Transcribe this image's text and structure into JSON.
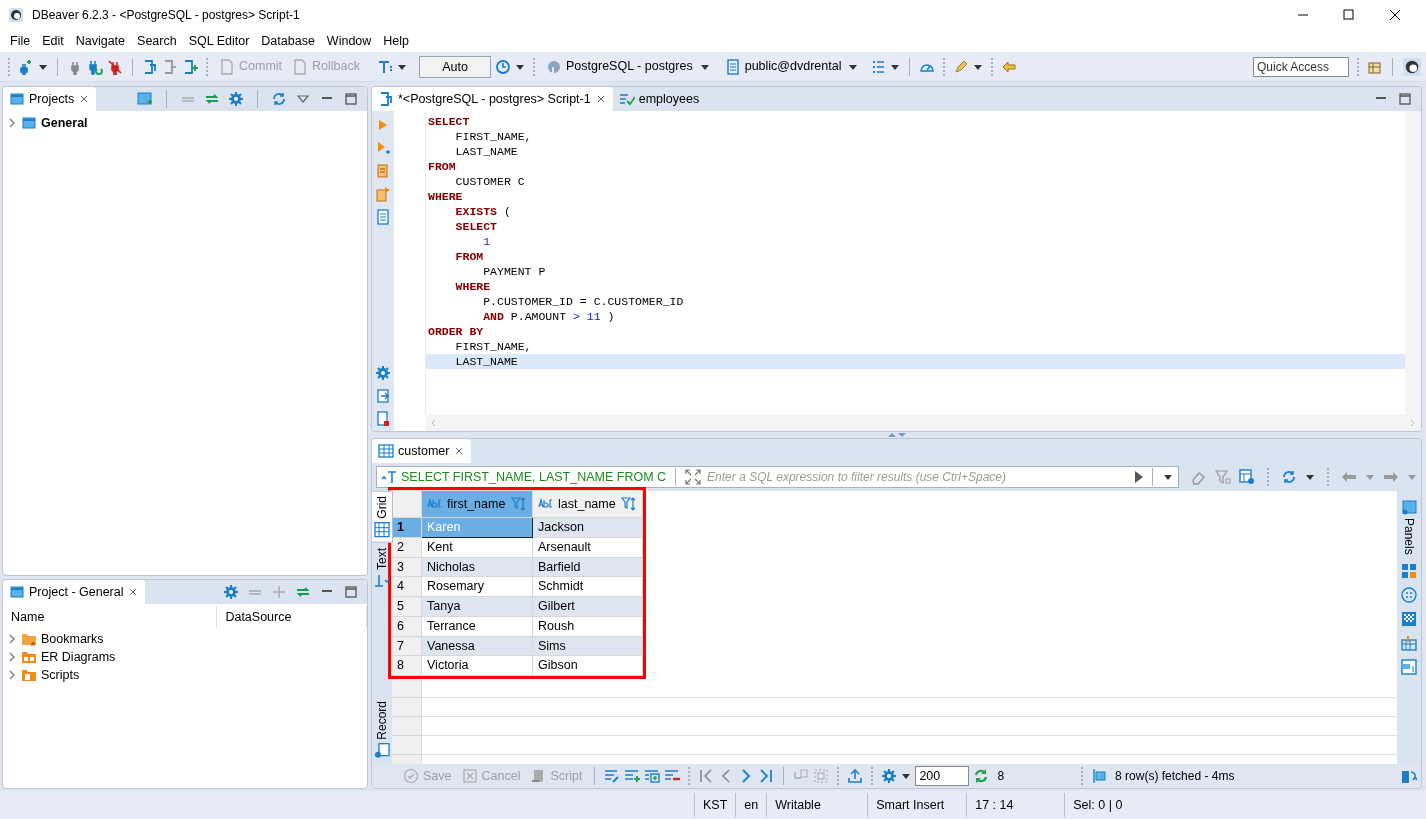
{
  "window": {
    "title": "DBeaver 6.2.3 - <PostgreSQL - postgres> Script-1"
  },
  "menu": [
    "File",
    "Edit",
    "Navigate",
    "Search",
    "SQL Editor",
    "Database",
    "Window",
    "Help"
  ],
  "toolbar": {
    "commit": {
      "label": "Commit",
      "disabled": true
    },
    "rollback": {
      "label": "Rollback",
      "disabled": true
    },
    "transaction_mode": "Auto",
    "datasource": "PostgreSQL - postgres",
    "schema": "public@dvdrental",
    "quick_access": {
      "placeholder": "Quick Access"
    }
  },
  "projects_panel": {
    "title": "Projects",
    "tree": [
      {
        "label": "General",
        "expanded": false
      }
    ]
  },
  "project_panel": {
    "title": "Project - General",
    "columns": [
      "Name",
      "DataSource"
    ],
    "items": [
      {
        "label": "Bookmarks",
        "expanded": false,
        "kind": "bookmarks"
      },
      {
        "label": "ER Diagrams",
        "expanded": false,
        "kind": "diagrams"
      },
      {
        "label": "Scripts",
        "expanded": false,
        "kind": "scripts"
      }
    ]
  },
  "editor": {
    "tabs": [
      {
        "label": "*<PostgreSQL - postgres> Script-1",
        "selected": true,
        "kind": "script"
      },
      {
        "label": "employees",
        "selected": false,
        "kind": "table"
      }
    ],
    "lines": [
      {
        "current": false,
        "segments": [
          {
            "text": "SELECT",
            "kind": "keyword"
          }
        ]
      },
      {
        "current": false,
        "segments": [
          {
            "text": "    FIRST_NAME,",
            "kind": "plain"
          }
        ]
      },
      {
        "current": false,
        "segments": [
          {
            "text": "    LAST_NAME",
            "kind": "plain"
          }
        ]
      },
      {
        "current": false,
        "segments": [
          {
            "text": "FROM",
            "kind": "keyword"
          }
        ]
      },
      {
        "current": false,
        "segments": [
          {
            "text": "    CUSTOMER C",
            "kind": "plain"
          }
        ]
      },
      {
        "current": false,
        "segments": [
          {
            "text": "WHERE",
            "kind": "keyword"
          }
        ]
      },
      {
        "current": false,
        "segments": [
          {
            "text": "    EXISTS",
            "kind": "keyword"
          },
          {
            "text": " (",
            "kind": "plain"
          }
        ]
      },
      {
        "current": false,
        "segments": [
          {
            "text": "    SELECT",
            "kind": "keyword"
          }
        ]
      },
      {
        "current": false,
        "segments": [
          {
            "text": "        1",
            "kind": "number"
          }
        ]
      },
      {
        "current": false,
        "segments": [
          {
            "text": "    FROM",
            "kind": "keyword"
          }
        ]
      },
      {
        "current": false,
        "segments": [
          {
            "text": "        PAYMENT P",
            "kind": "plain"
          }
        ]
      },
      {
        "current": false,
        "segments": [
          {
            "text": "    WHERE",
            "kind": "keyword"
          }
        ]
      },
      {
        "current": false,
        "segments": [
          {
            "text": "        P.CUSTOMER_ID = C.CUSTOMER_ID",
            "kind": "plain"
          }
        ]
      },
      {
        "current": false,
        "segments": [
          {
            "text": "        AND",
            "kind": "keyword"
          },
          {
            "text": " P.AMOUNT ",
            "kind": "plain"
          },
          {
            "text": ">",
            "kind": "operator"
          },
          {
            "text": " 11",
            "kind": "number"
          },
          {
            "text": " )",
            "kind": "plain"
          }
        ]
      },
      {
        "current": false,
        "segments": [
          {
            "text": "ORDER BY",
            "kind": "keyword"
          }
        ]
      },
      {
        "current": false,
        "segments": [
          {
            "text": "    FIRST_NAME,",
            "kind": "plain"
          }
        ]
      },
      {
        "current": true,
        "segments": [
          {
            "text": "    LAST_NAME",
            "kind": "plain"
          }
        ]
      }
    ]
  },
  "results": {
    "tab": "customer",
    "query": "SELECT FIRST_NAME, LAST_NAME FROM C",
    "filter": {
      "placeholder": "Enter a SQL expression to filter results (use Ctrl+Space)"
    },
    "view_tabs": [
      {
        "label": "Grid",
        "selected": true,
        "kind": "grid"
      },
      {
        "label": "Text",
        "selected": false,
        "kind": "text"
      },
      {
        "label": "Record",
        "selected": false,
        "kind": "record"
      }
    ],
    "panels_label": "Panels",
    "highlighted": true,
    "columns": [
      "first_name",
      "last_name"
    ],
    "rows": [
      {
        "number": "1",
        "cells": [
          "Karen",
          "Jackson"
        ],
        "selected": true
      },
      {
        "number": "2",
        "cells": [
          "Kent",
          "Arsenault"
        ],
        "selected": false
      },
      {
        "number": "3",
        "cells": [
          "Nicholas",
          "Barfield"
        ],
        "selected": false
      },
      {
        "number": "4",
        "cells": [
          "Rosemary",
          "Schmidt"
        ],
        "selected": false
      },
      {
        "number": "5",
        "cells": [
          "Tanya",
          "Gilbert"
        ],
        "selected": false
      },
      {
        "number": "6",
        "cells": [
          "Terrance",
          "Roush"
        ],
        "selected": false
      },
      {
        "number": "7",
        "cells": [
          "Vanessa",
          "Sims"
        ],
        "selected": false
      },
      {
        "number": "8",
        "cells": [
          "Victoria",
          "Gibson"
        ],
        "selected": false
      }
    ],
    "buttons": [
      {
        "label": "Save",
        "disabled": true,
        "kind": "save"
      },
      {
        "label": "Cancel",
        "disabled": true,
        "kind": "cancel"
      },
      {
        "label": "Script",
        "disabled": true,
        "kind": "script"
      }
    ],
    "page_size": "200",
    "row_count": "8",
    "message": "8 row(s) fetched - 4ms"
  },
  "status_bar": [
    "KST",
    "en",
    "Writable",
    "Smart Insert",
    "17 : 14",
    "Sel: 0 | 0"
  ]
}
